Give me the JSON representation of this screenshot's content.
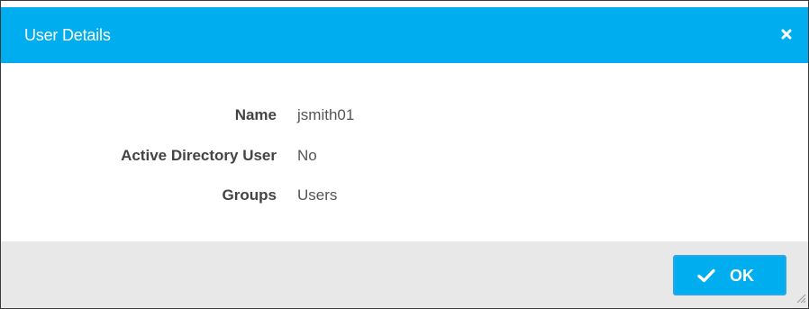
{
  "dialog": {
    "title": "User Details",
    "close_icon": "close-icon"
  },
  "details": [
    {
      "label": "Name",
      "value": "jsmith01"
    },
    {
      "label": "Active Directory User",
      "value": "No"
    },
    {
      "label": "Groups",
      "value": "Users"
    }
  ],
  "footer": {
    "ok_label": "OK",
    "ok_icon": "checkmark-icon"
  },
  "colors": {
    "header_bg": "#00aeef",
    "footer_bg": "#e8e8e8",
    "button_bg": "#00aeef",
    "label_text": "#444444",
    "value_text": "#555555"
  }
}
